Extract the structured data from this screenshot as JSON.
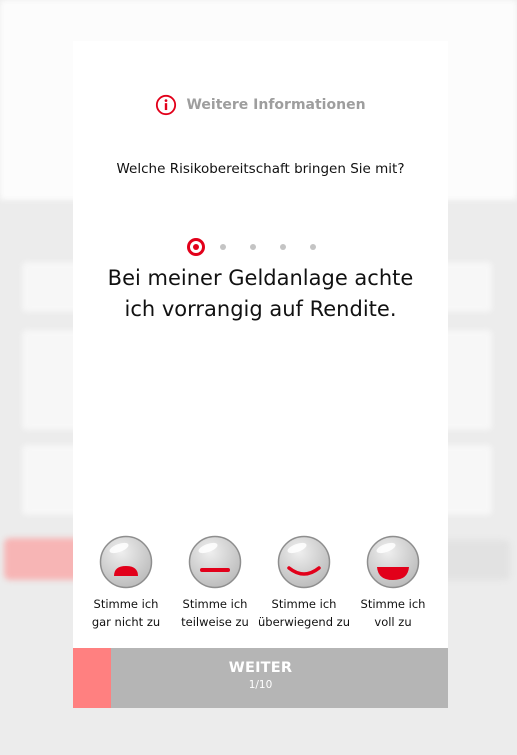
{
  "modal": {
    "info_link": "Weitere Informationen",
    "question": "Welche Risikobereitschaft bringen Sie mit?",
    "statement": "Bei meiner Geldanlage achte ich vorrangig auf Rendite.",
    "pager": {
      "current": 1,
      "total": 5
    },
    "options": [
      {
        "line1": "Stimme ich",
        "line2": "gar nicht zu",
        "icon": "frown-face-icon"
      },
      {
        "line1": "Stimme ich",
        "line2": "teilweise zu",
        "icon": "neutral-face-icon"
      },
      {
        "line1": "Stimme ich",
        "line2": "überwiegend zu",
        "icon": "smile-face-icon"
      },
      {
        "line1": "Stimme ich",
        "line2": "voll zu",
        "icon": "big-smile-face-icon"
      }
    ],
    "next_button": {
      "label": "WEITER",
      "counter": "1/10",
      "progress": 0.1
    }
  },
  "colors": {
    "accent": "#e2001a",
    "button_gray": "#b5b5b5",
    "progress_red": "#ff8080",
    "info_gray": "#9e9e9e"
  }
}
